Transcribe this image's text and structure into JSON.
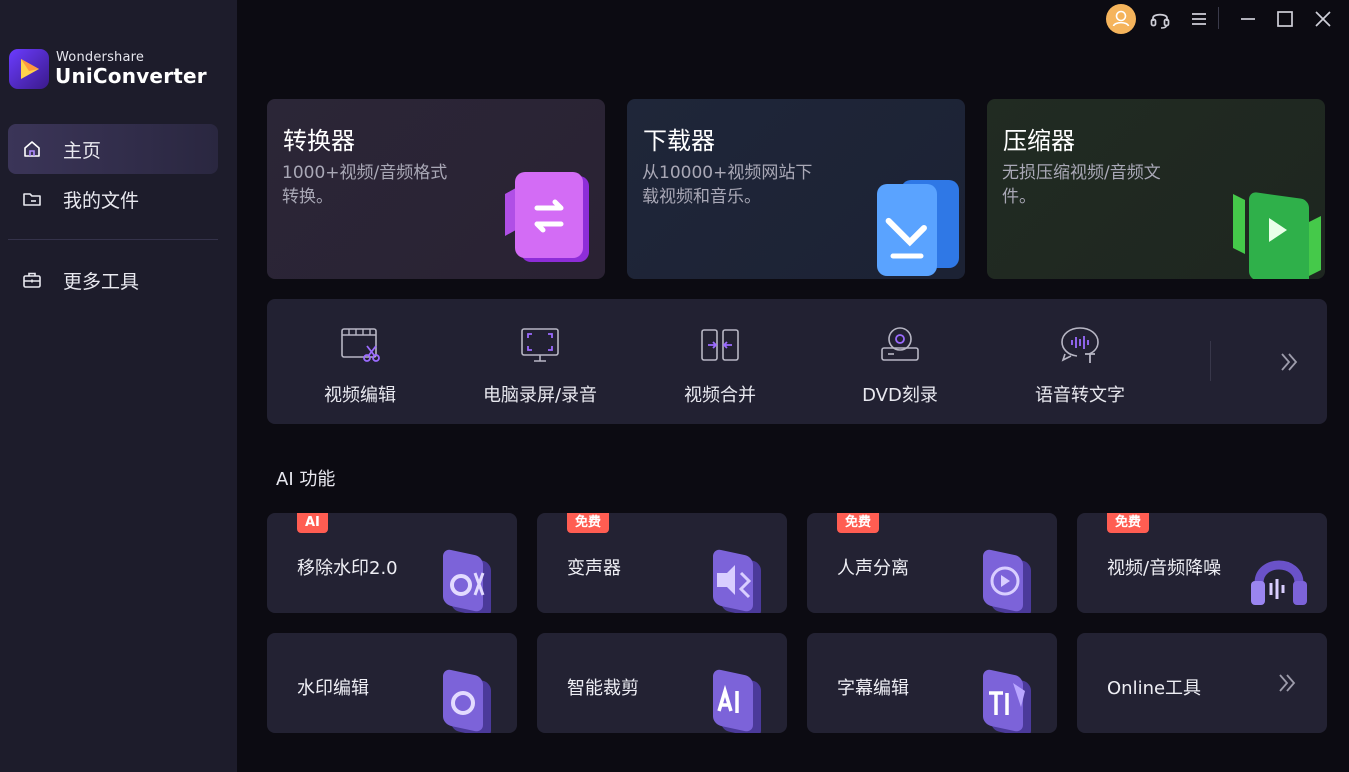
{
  "app": {
    "brand_top": "Wondershare",
    "brand_name": "UniConverter"
  },
  "sidebar": {
    "items": [
      {
        "label": "主页",
        "icon": "home-icon"
      },
      {
        "label": "我的文件",
        "icon": "folder-icon"
      },
      {
        "label": "更多工具",
        "icon": "toolbox-icon"
      }
    ]
  },
  "topbar": {
    "icons": [
      "avatar-icon",
      "headset-icon",
      "menu-icon",
      "minimize-icon",
      "maximize-icon",
      "close-icon"
    ]
  },
  "features": [
    {
      "title": "转换器",
      "desc": "1000+视频/音频格式转换。",
      "bg": "#2a2535"
    },
    {
      "title": "下载器",
      "desc": "从10000+视频网站下载视频和音乐。",
      "bg": "#1e2538"
    },
    {
      "title": "压缩器",
      "desc": "无损压缩视频/音频文件。",
      "bg": "#1f2a22"
    }
  ],
  "tools": [
    {
      "label": "视频编辑",
      "icon": "video-edit-icon"
    },
    {
      "label": "电脑录屏/录音",
      "icon": "screen-record-icon"
    },
    {
      "label": "视频合并",
      "icon": "merge-icon"
    },
    {
      "label": "DVD刻录",
      "icon": "dvd-icon"
    },
    {
      "label": "语音转文字",
      "icon": "speech-to-text-icon"
    }
  ],
  "ai_section": {
    "title": "AI 功能",
    "cards": [
      {
        "label": "移除水印2.0",
        "badge": "AI"
      },
      {
        "label": "变声器",
        "badge": "免费"
      },
      {
        "label": "人声分离",
        "badge": "免费"
      },
      {
        "label": "视频/音频降噪",
        "badge": "免费"
      },
      {
        "label": "水印编辑",
        "badge": ""
      },
      {
        "label": "智能裁剪",
        "badge": ""
      },
      {
        "label": "字幕编辑",
        "badge": ""
      },
      {
        "label": "Online工具",
        "badge": ""
      }
    ]
  },
  "colors": {
    "accent_purple": "#8b5cf6",
    "badge_red": "#ff5d52",
    "avatar_orange": "#f5b45c"
  }
}
